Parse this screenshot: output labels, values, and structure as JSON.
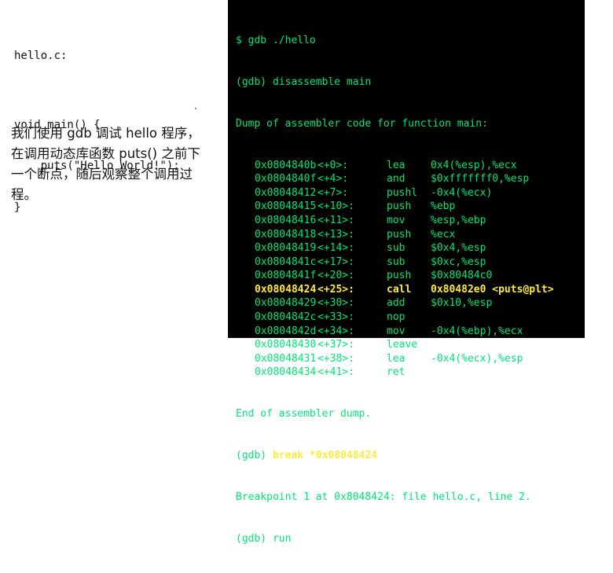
{
  "source": {
    "lines": [
      "hello.c:",
      "",
      "void main() {",
      "    puts(\"Hello World!\");",
      "}"
    ]
  },
  "description": "我们使用 gdb 调试 hello 程序，在调用动态库函数 puts() 之前下一个断点，随后观察整个调用过程。",
  "terminal": {
    "cmd1": "$ gdb ./hello",
    "cmd2": "(gdb) disassemble main",
    "dump_header": "Dump of assembler code for function main:",
    "instructions": [
      {
        "addr": "0x0804840b",
        "off": "<+0>:",
        "mnemonic": "lea",
        "operands": "0x4(%esp),%ecx"
      },
      {
        "addr": "0x0804840f",
        "off": "<+4>:",
        "mnemonic": "and",
        "operands": "$0xfffffff0,%esp"
      },
      {
        "addr": "0x08048412",
        "off": "<+7>:",
        "mnemonic": "pushl",
        "operands": "-0x4(%ecx)"
      },
      {
        "addr": "0x08048415",
        "off": "<+10>:",
        "mnemonic": "push",
        "operands": "%ebp"
      },
      {
        "addr": "0x08048416",
        "off": "<+11>:",
        "mnemonic": "mov",
        "operands": "%esp,%ebp"
      },
      {
        "addr": "0x08048418",
        "off": "<+13>:",
        "mnemonic": "push",
        "operands": "%ecx"
      },
      {
        "addr": "0x08048419",
        "off": "<+14>:",
        "mnemonic": "sub",
        "operands": "$0x4,%esp"
      },
      {
        "addr": "0x0804841c",
        "off": "<+17>:",
        "mnemonic": "sub",
        "operands": "$0xc,%esp"
      },
      {
        "addr": "0x0804841f",
        "off": "<+20>:",
        "mnemonic": "push",
        "operands": "$0x80484c0"
      },
      {
        "addr": "0x08048424",
        "off": "<+25>:",
        "mnemonic": "call",
        "operands": "0x80482e0 <puts@plt>",
        "highlight": true
      },
      {
        "addr": "0x08048429",
        "off": "<+30>:",
        "mnemonic": "add",
        "operands": "$0x10,%esp"
      },
      {
        "addr": "0x0804842c",
        "off": "<+33>:",
        "mnemonic": "nop",
        "operands": ""
      },
      {
        "addr": "0x0804842d",
        "off": "<+34>:",
        "mnemonic": "mov",
        "operands": "-0x4(%ebp),%ecx"
      },
      {
        "addr": "0x08048430",
        "off": "<+37>:",
        "mnemonic": "leave",
        "operands": ""
      },
      {
        "addr": "0x08048431",
        "off": "<+38>:",
        "mnemonic": "lea",
        "operands": "-0x4(%ecx),%esp"
      },
      {
        "addr": "0x08048434",
        "off": "<+41>:",
        "mnemonic": "ret",
        "operands": ""
      }
    ],
    "dump_end": "End of assembler dump.",
    "break_prompt": "(gdb) ",
    "break_cmd": "break *0x08048424",
    "breakpoint_msg": "Breakpoint 1 at 0x8048424: file hello.c, line 2.",
    "run_cmd": "(gdb) run"
  },
  "colors": {
    "terminal_bg": "#000000",
    "terminal_text": "#00e676",
    "highlight": "#ffeb3b"
  }
}
